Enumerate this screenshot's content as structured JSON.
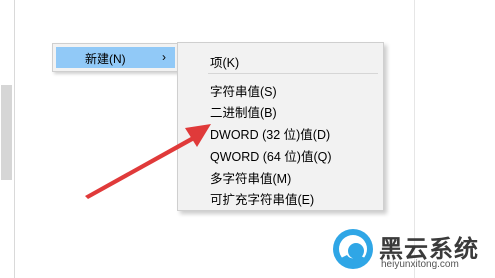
{
  "context_menu": {
    "new_label": "新建(N)",
    "arrow": "›"
  },
  "submenu": {
    "items": [
      "项(K)",
      "字符串值(S)",
      "二进制值(B)",
      "DWORD (32 位)值(D)",
      "QWORD (64 位)值(Q)",
      "多字符串值(M)",
      "可扩充字符串值(E)"
    ]
  },
  "annotation": {
    "arrow_color": "#e03a3a",
    "icon": "red-pointer-arrow-icon"
  },
  "watermark": {
    "title": "黑云系统",
    "subtitle": "heiyunxitong.com",
    "icon": "heiyun-logo-icon"
  },
  "colors": {
    "menu_bg": "#f2f2f2",
    "highlight": "#91c9f7",
    "logo_blue": "#2fa6e6"
  }
}
